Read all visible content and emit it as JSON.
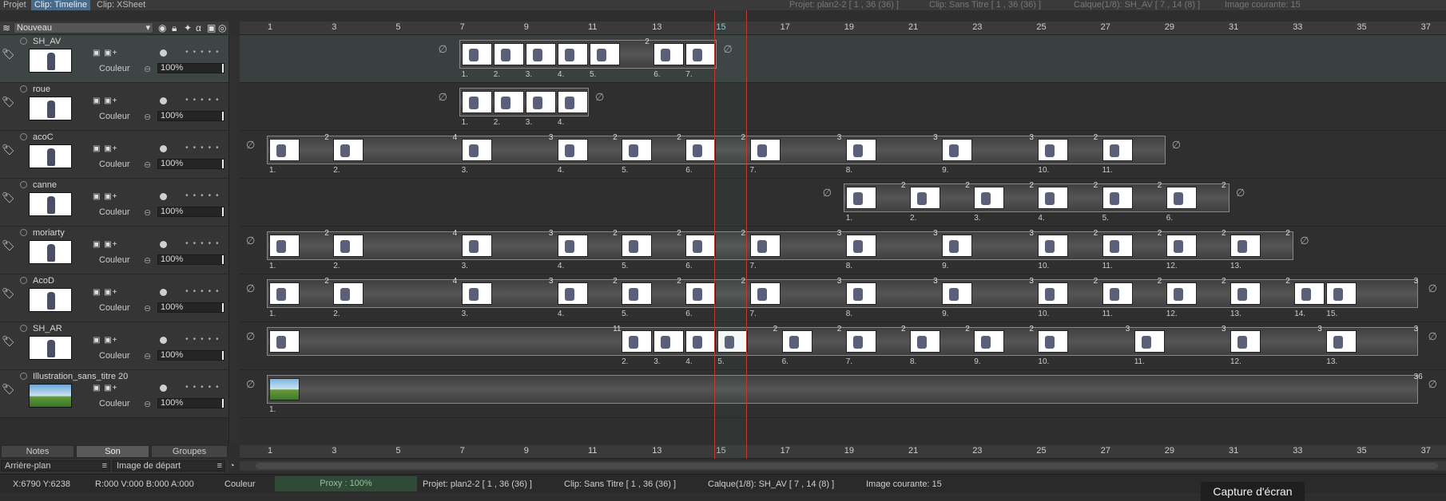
{
  "menu": {
    "tabs": [
      "Projet",
      "Clip: Timeline",
      "Clip: XSheet"
    ]
  },
  "top_info": {
    "projet": "Projet: plan2-2 [ 1 , 36  (36) ]",
    "clip": "Clip: Sans Titre [ 1 , 36  (36) ]",
    "calque": "Calque(1/8): SH_AV [ 7 , 14  (8) ]",
    "image": "Image courante: 15"
  },
  "header": {
    "new_layer": "Nouveau"
  },
  "ruler": {
    "labels": [
      "1",
      "3",
      "5",
      "7",
      "9",
      "11",
      "13",
      "15",
      "17",
      "19",
      "21",
      "23",
      "25",
      "27",
      "29",
      "31",
      "33",
      "35",
      "37"
    ],
    "current": "15"
  },
  "layer_defaults": {
    "blend": "Couleur",
    "opacity": "100%",
    "ctrl_glyphs": "▣ ▣+"
  },
  "layers": [
    {
      "name": "SH_AV"
    },
    {
      "name": "roue"
    },
    {
      "name": "acoC"
    },
    {
      "name": "canne"
    },
    {
      "name": "moriarty"
    },
    {
      "name": "AcoD"
    },
    {
      "name": "SH_AR"
    },
    {
      "name": "Illustration_sans_titre 20"
    }
  ],
  "tracks": [
    {
      "empty_before": 7,
      "empty_after": 15,
      "clips": [
        {
          "start": 7,
          "end": 15,
          "frames": [
            {
              "s": 7,
              "w": 1,
              "label": "1."
            },
            {
              "s": 8,
              "w": 1,
              "label": "2."
            },
            {
              "s": 9,
              "w": 1,
              "label": "3."
            },
            {
              "s": 10,
              "w": 1,
              "label": "4."
            },
            {
              "s": 11,
              "w": 2,
              "label": "5.",
              "hold": "2"
            },
            {
              "s": 13,
              "w": 1,
              "label": "6."
            },
            {
              "s": 14,
              "w": 1,
              "label": "7."
            }
          ]
        }
      ]
    },
    {
      "empty_before": 7,
      "empty_after": 11,
      "clips": [
        {
          "start": 7,
          "end": 11,
          "frames": [
            {
              "s": 7,
              "w": 1,
              "label": "1."
            },
            {
              "s": 8,
              "w": 1,
              "label": "2."
            },
            {
              "s": 9,
              "w": 1,
              "label": "3."
            },
            {
              "s": 10,
              "w": 1,
              "label": "4."
            }
          ]
        }
      ]
    },
    {
      "empty_before": 1,
      "empty_after": 29,
      "clips": [
        {
          "start": 1,
          "end": 29,
          "frames": [
            {
              "s": 1,
              "w": 2,
              "label": "1.",
              "hold": "2"
            },
            {
              "s": 3,
              "w": 4,
              "label": "2.",
              "hold": "4"
            },
            {
              "s": 7,
              "w": 3,
              "label": "3.",
              "hold": "3"
            },
            {
              "s": 10,
              "w": 2,
              "label": "4.",
              "hold": "2"
            },
            {
              "s": 12,
              "w": 2,
              "label": "5.",
              "hold": "2"
            },
            {
              "s": 14,
              "w": 2,
              "label": "6.",
              "hold": "2"
            },
            {
              "s": 16,
              "w": 3,
              "label": "7.",
              "hold": "3"
            },
            {
              "s": 19,
              "w": 3,
              "label": "8.",
              "hold": "3"
            },
            {
              "s": 22,
              "w": 3,
              "label": "9.",
              "hold": "3"
            },
            {
              "s": 25,
              "w": 2,
              "label": "10.",
              "hold": "2"
            },
            {
              "s": 27,
              "w": 1,
              "label": "11."
            }
          ]
        }
      ]
    },
    {
      "empty_before": 19,
      "empty_after": 31,
      "clips": [
        {
          "start": 19,
          "end": 31,
          "frames": [
            {
              "s": 19,
              "w": 2,
              "label": "1.",
              "hold": "2"
            },
            {
              "s": 21,
              "w": 2,
              "label": "2.",
              "hold": "2"
            },
            {
              "s": 23,
              "w": 2,
              "label": "3.",
              "hold": "2"
            },
            {
              "s": 25,
              "w": 2,
              "label": "4.",
              "hold": "2"
            },
            {
              "s": 27,
              "w": 2,
              "label": "5.",
              "hold": "2"
            },
            {
              "s": 29,
              "w": 2,
              "label": "6.",
              "hold": "2"
            }
          ]
        }
      ]
    },
    {
      "empty_before": 1,
      "empty_after": 33,
      "clips": [
        {
          "start": 1,
          "end": 33,
          "frames": [
            {
              "s": 1,
              "w": 2,
              "label": "1.",
              "hold": "2"
            },
            {
              "s": 3,
              "w": 4,
              "label": "2.",
              "hold": "4"
            },
            {
              "s": 7,
              "w": 3,
              "label": "3.",
              "hold": "3"
            },
            {
              "s": 10,
              "w": 2,
              "label": "4.",
              "hold": "2"
            },
            {
              "s": 12,
              "w": 2,
              "label": "5.",
              "hold": "2"
            },
            {
              "s": 14,
              "w": 2,
              "label": "6.",
              "hold": "2"
            },
            {
              "s": 16,
              "w": 3,
              "label": "7.",
              "hold": "3"
            },
            {
              "s": 19,
              "w": 3,
              "label": "8.",
              "hold": "3"
            },
            {
              "s": 22,
              "w": 3,
              "label": "9.",
              "hold": "3"
            },
            {
              "s": 25,
              "w": 2,
              "label": "10.",
              "hold": "2"
            },
            {
              "s": 27,
              "w": 2,
              "label": "11.",
              "hold": "2"
            },
            {
              "s": 29,
              "w": 2,
              "label": "12.",
              "hold": "2"
            },
            {
              "s": 31,
              "w": 2,
              "label": "13.",
              "hold": "2"
            }
          ]
        }
      ]
    },
    {
      "empty_before": 1,
      "empty_after": 37,
      "clips": [
        {
          "start": 1,
          "end": 37,
          "frames": [
            {
              "s": 1,
              "w": 2,
              "label": "1.",
              "hold": "2"
            },
            {
              "s": 3,
              "w": 4,
              "label": "2.",
              "hold": "4"
            },
            {
              "s": 7,
              "w": 3,
              "label": "3.",
              "hold": "3"
            },
            {
              "s": 10,
              "w": 2,
              "label": "4.",
              "hold": "2"
            },
            {
              "s": 12,
              "w": 2,
              "label": "5.",
              "hold": "2"
            },
            {
              "s": 14,
              "w": 2,
              "label": "6.",
              "hold": "2"
            },
            {
              "s": 16,
              "w": 3,
              "label": "7.",
              "hold": "3"
            },
            {
              "s": 19,
              "w": 3,
              "label": "8.",
              "hold": "3"
            },
            {
              "s": 22,
              "w": 3,
              "label": "9.",
              "hold": "3"
            },
            {
              "s": 25,
              "w": 2,
              "label": "10.",
              "hold": "2"
            },
            {
              "s": 27,
              "w": 2,
              "label": "11.",
              "hold": "2"
            },
            {
              "s": 29,
              "w": 2,
              "label": "12.",
              "hold": "2"
            },
            {
              "s": 31,
              "w": 2,
              "label": "13.",
              "hold": "2"
            },
            {
              "s": 33,
              "w": 1,
              "label": "14."
            },
            {
              "s": 34,
              "w": 3,
              "label": "15.",
              "hold": "3"
            }
          ]
        }
      ]
    },
    {
      "empty_before": 1,
      "empty_after": 37,
      "clips": [
        {
          "start": 1,
          "end": 37,
          "frames": [
            {
              "s": 1,
              "w": 11,
              "label": "",
              "hold": "11"
            },
            {
              "s": 12,
              "w": 1,
              "label": "2."
            },
            {
              "s": 13,
              "w": 1,
              "label": "3."
            },
            {
              "s": 14,
              "w": 1,
              "label": "4."
            },
            {
              "s": 15,
              "w": 2,
              "label": "5.",
              "hold": "2"
            },
            {
              "s": 17,
              "w": 2,
              "label": "6.",
              "hold": "2"
            },
            {
              "s": 19,
              "w": 2,
              "label": "7.",
              "hold": "2"
            },
            {
              "s": 21,
              "w": 2,
              "label": "8.",
              "hold": "2"
            },
            {
              "s": 23,
              "w": 2,
              "label": "9.",
              "hold": "2"
            },
            {
              "s": 25,
              "w": 3,
              "label": "10.",
              "hold": "3"
            },
            {
              "s": 28,
              "w": 3,
              "label": "11.",
              "hold": "3"
            },
            {
              "s": 31,
              "w": 3,
              "label": "12.",
              "hold": "3"
            },
            {
              "s": 34,
              "w": 3,
              "label": "13.",
              "hold": "3"
            }
          ]
        }
      ]
    },
    {
      "empty_before": 1,
      "empty_after": 37,
      "clips": [
        {
          "start": 1,
          "end": 37,
          "sky": true,
          "frames": [
            {
              "s": 1,
              "w": 36,
              "label": "1.",
              "hold": "36"
            }
          ]
        }
      ]
    }
  ],
  "bottom_tabs": [
    "Notes",
    "Son",
    "Groupes"
  ],
  "bottom_selects": {
    "background": "Arrière-plan",
    "start_image": "Image de départ"
  },
  "status": {
    "coords": "X:6790  Y:6238",
    "rgba": "R:000 V:000 B:000 A:000",
    "mode": "Couleur",
    "proxy": "Proxy : 100%",
    "projet": "Projet: plan2-2 [ 1 , 36  (36) ]",
    "clip": "Clip: Sans Titre [ 1 , 36  (36) ]",
    "calque": "Calque(1/8): SH_AV [ 7 , 14  (8) ]",
    "image": "Image courante: 15"
  },
  "capture_button": "Capture d'écran",
  "colors": {
    "current_line": "#c0392b",
    "selected_tab": "#4a6a8a"
  }
}
